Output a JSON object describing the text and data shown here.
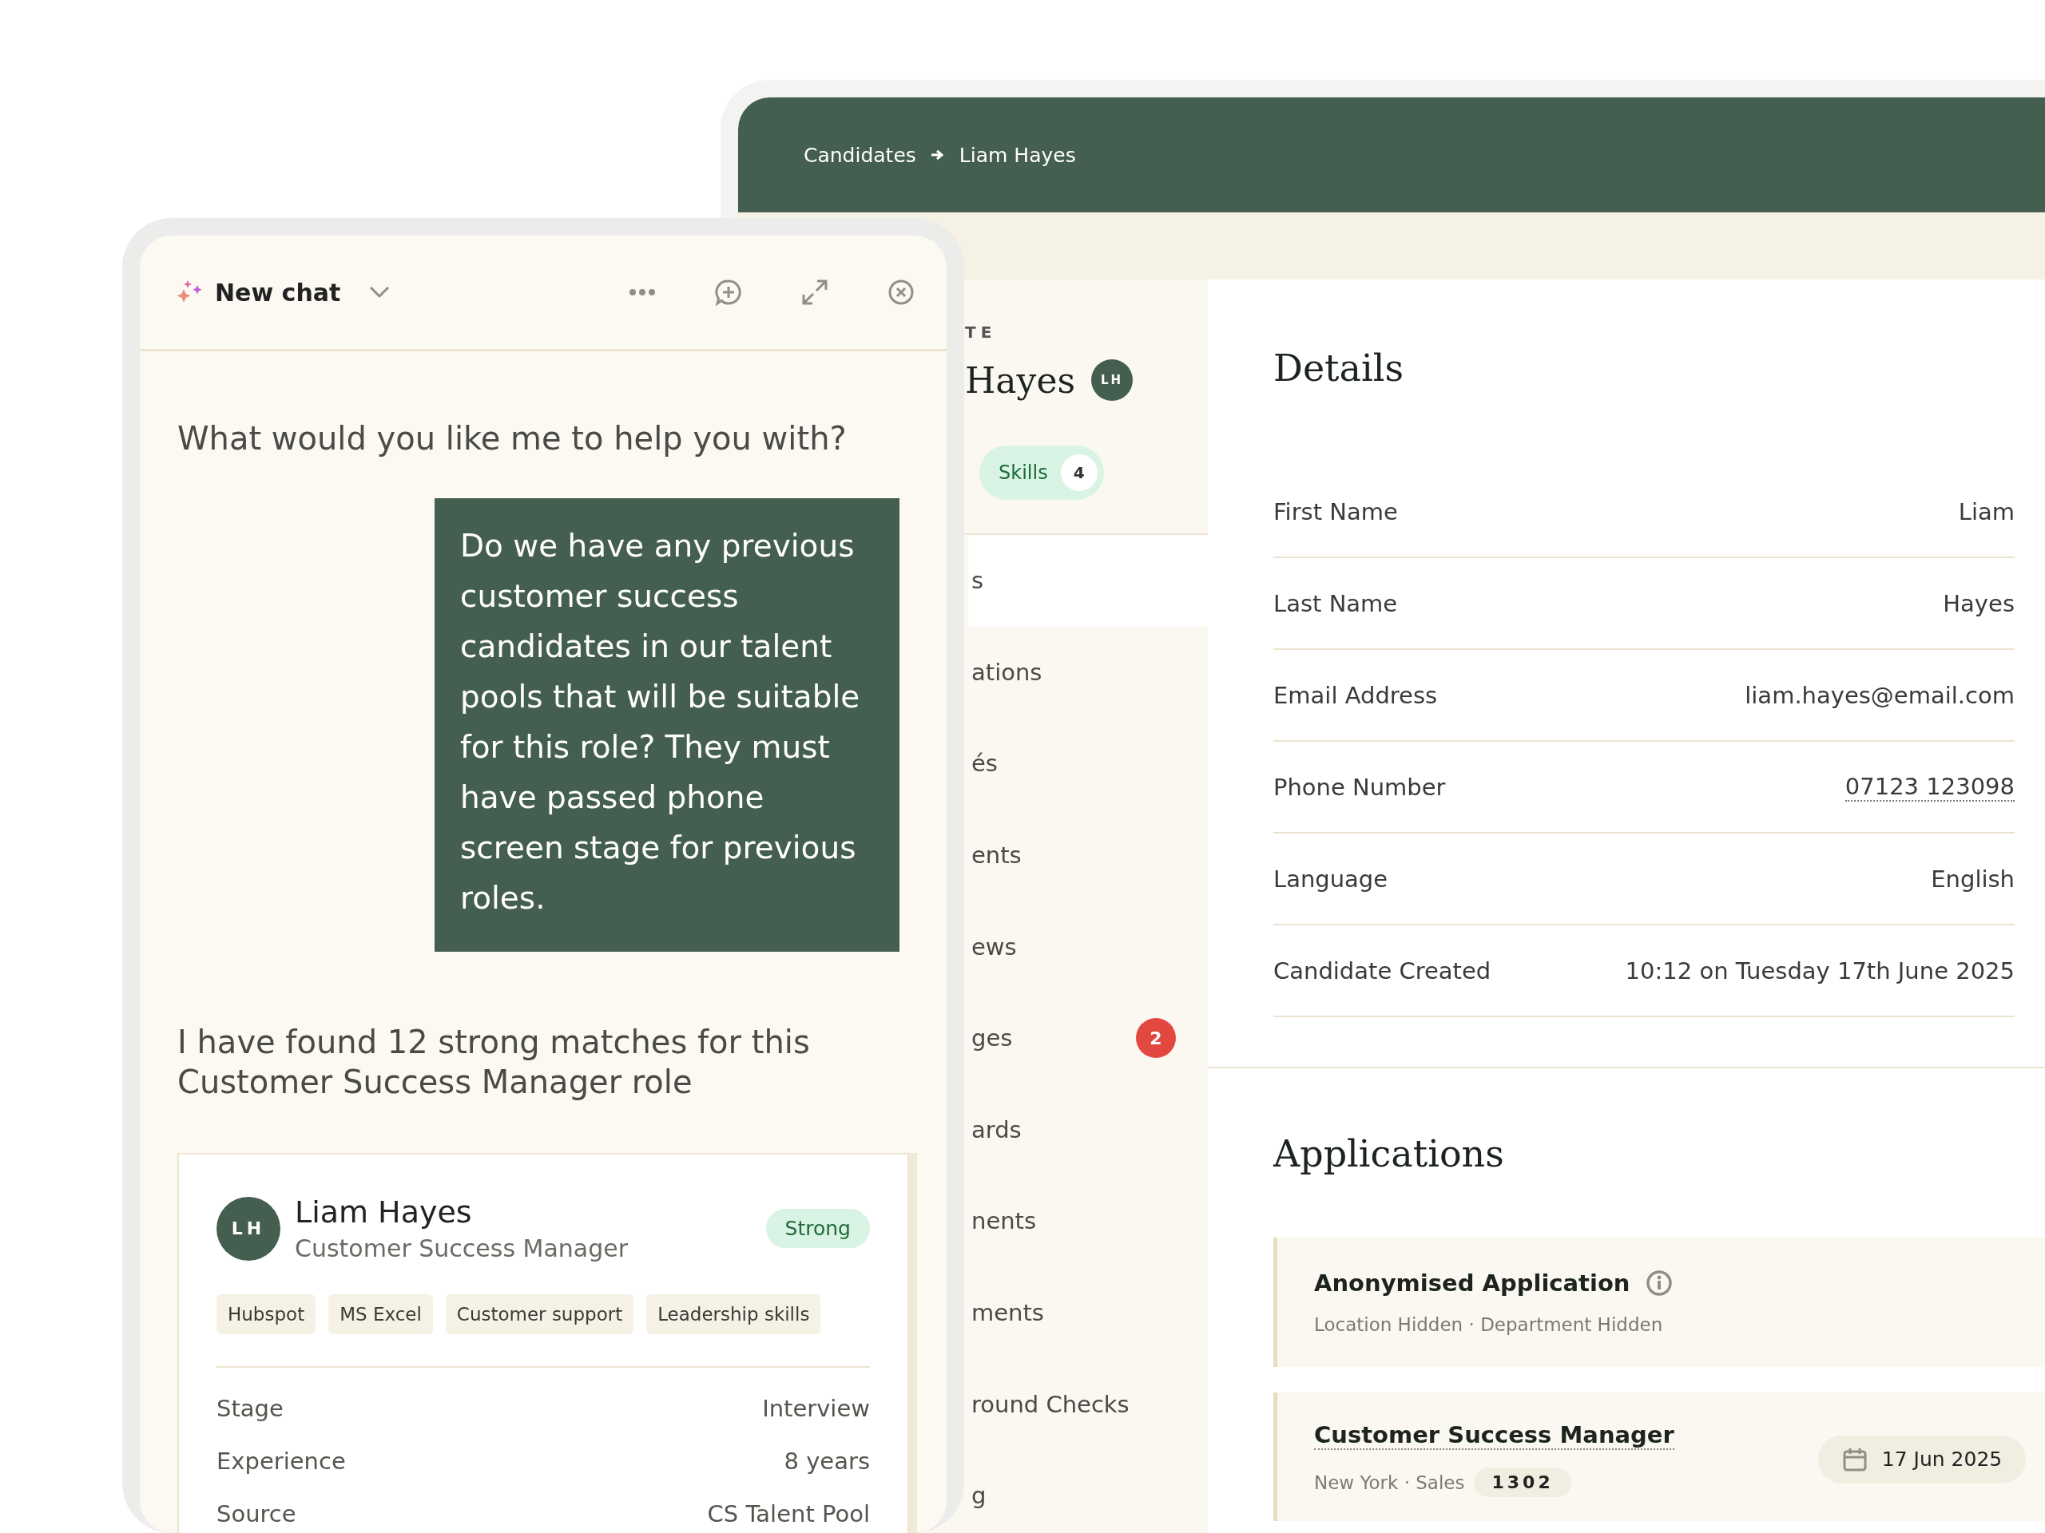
{
  "profile": {
    "breadcrumb": [
      "Candidates",
      "Liam Hayes"
    ],
    "sidebar": {
      "eyebrow": "TE",
      "name": "Hayes",
      "initials": "LH",
      "skills_tab": {
        "label": "Skills",
        "count": "4"
      },
      "items": [
        {
          "label": "s",
          "selected": true
        },
        {
          "label": "ations",
          "selected": false
        },
        {
          "label": "és",
          "selected": false
        },
        {
          "label": "ents",
          "selected": false
        },
        {
          "label": "ews",
          "selected": false
        },
        {
          "label": "ges",
          "selected": false,
          "badge": "2"
        },
        {
          "label": "ards",
          "selected": false
        },
        {
          "label": "nents",
          "selected": false
        },
        {
          "label": "ments",
          "selected": false
        },
        {
          "label": "round Checks",
          "selected": false
        },
        {
          "label": "g",
          "selected": false
        }
      ]
    },
    "details": {
      "title": "Details",
      "fields": [
        {
          "label": "First Name",
          "value": "Liam"
        },
        {
          "label": "Last Name",
          "value": "Hayes"
        },
        {
          "label": "Email Address",
          "value": "liam.hayes@email.com"
        },
        {
          "label": "Phone Number",
          "value": "07123 123098",
          "kind": "link"
        },
        {
          "label": "Language",
          "value": "English"
        },
        {
          "label": "Candidate Created",
          "value": "10:12 on Tuesday 17th June 2025"
        }
      ]
    },
    "applications": {
      "title": "Applications",
      "items": [
        {
          "kind": "anonymised",
          "title": "Anonymised Application",
          "meta": "Location Hidden · Department Hidden"
        },
        {
          "kind": "job",
          "title": "Customer Success Manager",
          "meta": "New York · Sales",
          "code": "1302",
          "date": "17 Jun 2025"
        }
      ]
    }
  },
  "chat": {
    "title": "New chat",
    "messages": [
      {
        "kind": "plain",
        "text": "What would you like me to help you with?"
      },
      {
        "kind": "bubble",
        "text": "Do we have any previous customer success candidates in our talent pools that will be suitable for this role? They must have passed phone screen stage for previous roles."
      },
      {
        "kind": "plain",
        "text": "I have found 12 strong matches for this Customer Success Manager role"
      }
    ],
    "candidate_card": {
      "initials": "LH",
      "name": "Liam Hayes",
      "role": "Customer Success Manager",
      "match": "Strong",
      "skills": [
        "Hubspot",
        "MS Excel",
        "Customer support",
        "Leadership skills"
      ],
      "facts": [
        {
          "label": "Stage",
          "value": "Interview"
        },
        {
          "label": "Experience",
          "value": "8 years"
        },
        {
          "label": "Source",
          "value": "CS Talent Pool"
        }
      ]
    }
  }
}
